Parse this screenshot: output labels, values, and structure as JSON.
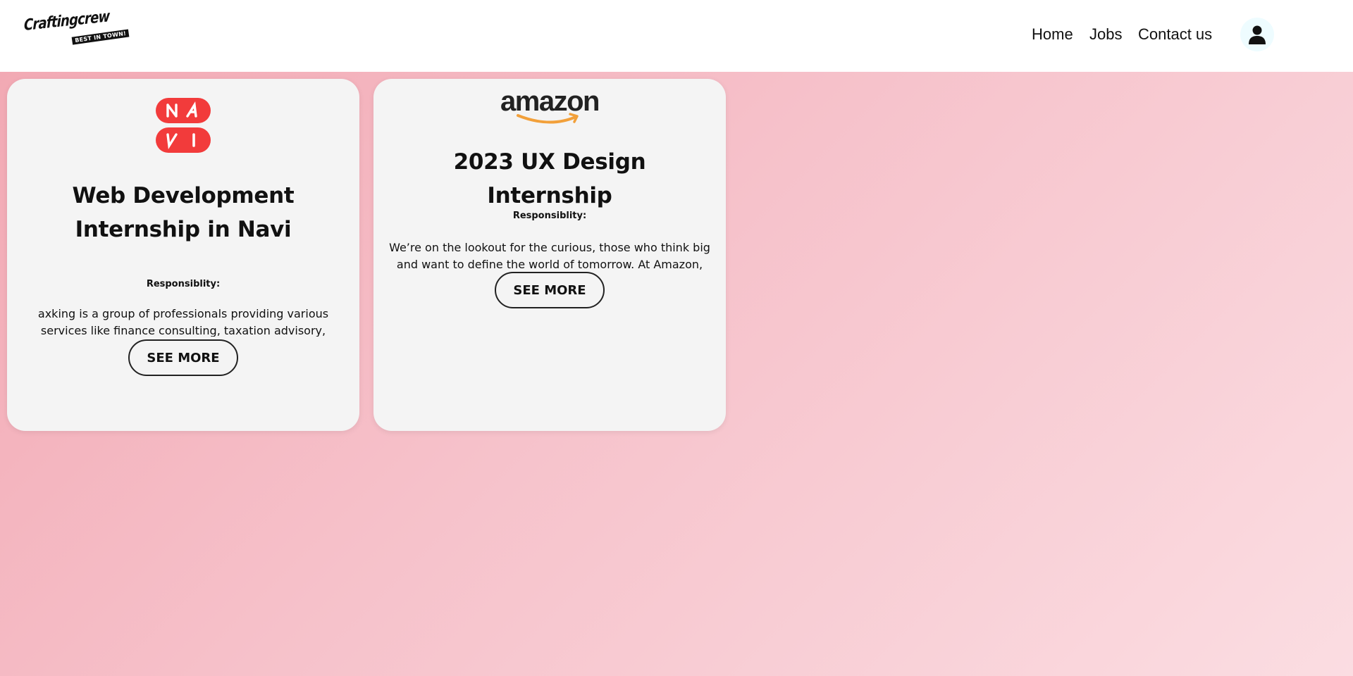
{
  "brand": {
    "name": "Craftingcrew",
    "tagline": "BEST IN TOWN!"
  },
  "nav": {
    "items": [
      "Home",
      "Jobs",
      "Contact us"
    ],
    "user_icon": "user-icon"
  },
  "cards": [
    {
      "company_logo": "navi-logo",
      "title": "Web Development Internship in Navi",
      "responsibility_label": "Responsiblity:",
      "description": "axking is a group of professionals providing various services like finance consulting, taxation advisory, startup",
      "button_label": "SEE MORE"
    },
    {
      "company_logo": "amazon-logo",
      "logo_text": "amazon",
      "title": "2023 UX Design Internship",
      "responsibility_label": "Responsiblity:",
      "description": "We’re on the lookout for the curious, those who think big and want to define the world of tomorrow. At Amazon, you",
      "button_label": "SEE MORE"
    }
  ],
  "colors": {
    "background_gradient_start": "#f2a7b2",
    "background_gradient_end": "#fbdde2",
    "card_bg": "#f4f4f4",
    "navi_red": "#f23b3b",
    "amazon_orange": "#f2a03a"
  }
}
